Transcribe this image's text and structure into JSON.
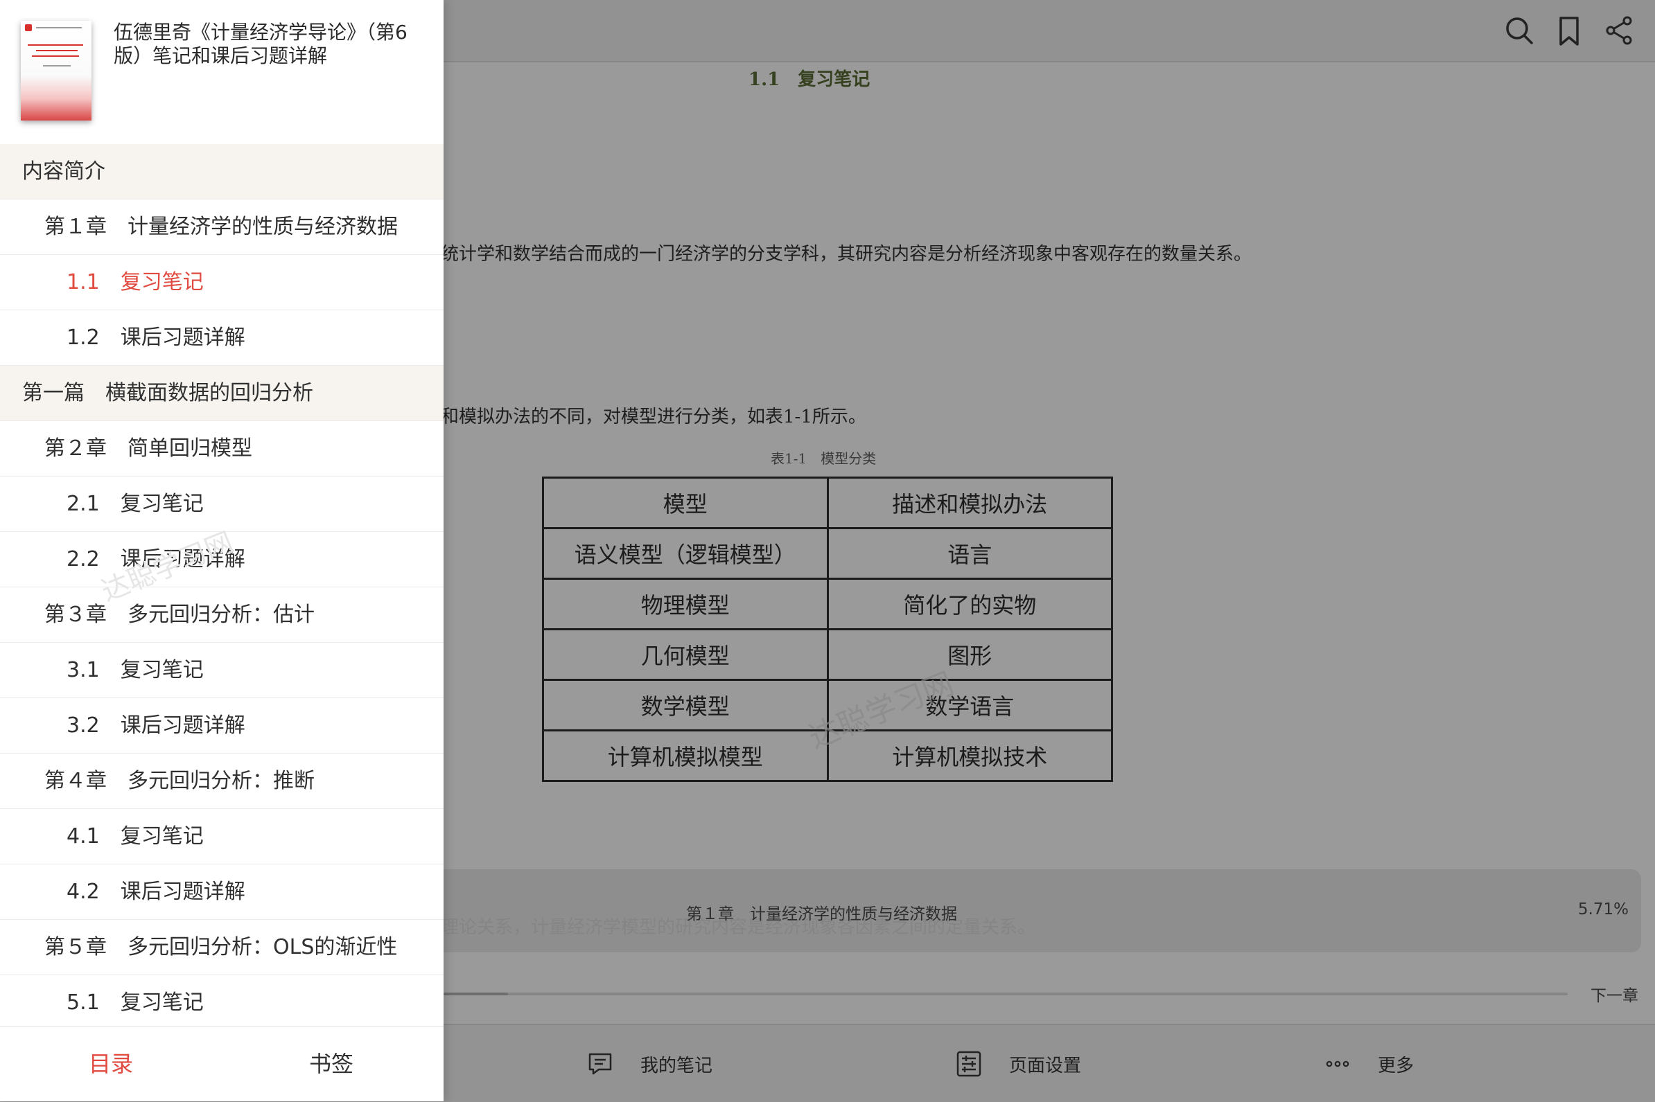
{
  "reader": {
    "section_heading": "1.1　复习笔记",
    "body_lines": [
      "统计学和数学结合而成的一门经济学的分支学科，其研究内容是分析经济现象中客观存在的数量关系。",
      "和模拟办法的不同，对模型进行分类，如表1-1所示。"
    ],
    "table_caption": "表1-1　模型分类",
    "table": {
      "headers": [
        "模型",
        "描述和模拟办法"
      ],
      "rows": [
        [
          "语义模型（逻辑模型）",
          "语言"
        ],
        [
          "物理模型",
          "简化了的实物"
        ],
        [
          "几何模型",
          "图形"
        ],
        [
          "数学模型",
          "数学语言"
        ],
        [
          "计算机模拟模型",
          "计算机模拟技术"
        ]
      ]
    },
    "watermark": "达聪学习网",
    "ghost_line": "理论关系，计量经济学模型的研究内容是经济现象各因素之间的定量关系。",
    "chapter_info": "第１章　计量经济学的性质与经济数据",
    "progress_text": "5.71%",
    "progress_fraction": 0.0571,
    "next_chapter": "下一章",
    "bottom_bar": {
      "notes_label": "我的笔记",
      "page_settings_label": "页面设置",
      "more_label": "更多"
    },
    "icons": {
      "search": "search-icon",
      "bookmark": "bookmark-icon",
      "share": "share-icon",
      "notes": "notes-icon",
      "settings": "sliders-icon",
      "more": "more-dots-icon"
    }
  },
  "drawer": {
    "book_title": "伍德里奇《计量经济学导论》（第6版）笔记和课后习题详解",
    "toc": [
      {
        "label": "内容简介",
        "level": "part"
      },
      {
        "label": "第１章　计量经济学的性质与经济数据",
        "level": "chapter"
      },
      {
        "label": "1.1　复习笔记",
        "level": "section",
        "active": true
      },
      {
        "label": "1.2　课后习题详解",
        "level": "section"
      },
      {
        "label": "第一篇　横截面数据的回归分析",
        "level": "part"
      },
      {
        "label": "第２章　简单回归模型",
        "level": "chapter"
      },
      {
        "label": "2.1　复习笔记",
        "level": "section"
      },
      {
        "label": "2.2　课后习题详解",
        "level": "section"
      },
      {
        "label": "第３章　多元回归分析：估计",
        "level": "chapter"
      },
      {
        "label": "3.1　复习笔记",
        "level": "section"
      },
      {
        "label": "3.2　课后习题详解",
        "level": "section"
      },
      {
        "label": "第４章　多元回归分析：推断",
        "level": "chapter"
      },
      {
        "label": "4.1　复习笔记",
        "level": "section"
      },
      {
        "label": "4.2　课后习题详解",
        "level": "section"
      },
      {
        "label": "第５章　多元回归分析：OLS的渐近性",
        "level": "chapter"
      },
      {
        "label": "5.1　复习笔记",
        "level": "section"
      }
    ],
    "tabs": {
      "toc": "目录",
      "bookmarks": "书签"
    },
    "accent_color": "#e04a3f"
  }
}
